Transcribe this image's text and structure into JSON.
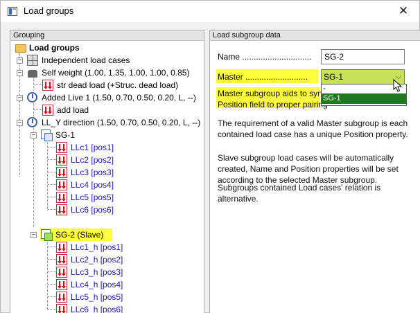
{
  "window": {
    "title": "Load groups",
    "close": "✕"
  },
  "left_panel": {
    "header": "Grouping",
    "tree": {
      "root": "Load groups",
      "independent": "Independent load cases",
      "self_weight": "Self weight  (1.00, 1.35, 1.00, 1.00, 0.85)",
      "str_dead": "str dead load  (+Struc. dead load)",
      "added_live": "Added Live 1  (1.50, 0.70, 0.50, 0.20, L, --)",
      "add_load": "add load",
      "ll_y": "LL_Y direction  (1.50, 0.70, 0.50, 0.20, L, --)",
      "sg1": "SG-1",
      "sg1_items": [
        "LLc1  [pos1]",
        "LLc2  [pos2]",
        "LLc3  [pos3]",
        "LLc4  [pos4]",
        "LLc5  [pos5]",
        "LLc6  [pos6]"
      ],
      "sg2": "SG-2  (Slave)",
      "sg2_items": [
        "LLc1_h  [pos1]",
        "LLc2_h  [pos2]",
        "LLc3_h  [pos3]",
        "LLc4_h  [pos4]",
        "LLc5_h  [pos5]",
        "LLc6_h  [pos6]"
      ]
    }
  },
  "right_panel": {
    "header": "Load subgroup data",
    "name_label": "Name ..............................",
    "name_value": "SG-2",
    "master_label": "Master ...........................",
    "master_value": "SG-1",
    "master_options": [
      "-",
      "SG-1"
    ],
    "para1a": "Master subgroup aids to synch",
    "para1b": "Position field to proper pairing",
    "para2": "The requirement of a valid Master subgroup is each contained load case has a unique Position property.",
    "para3": "Slave subgroup load cases will be automatically created, Name and Position properties will be set according to the selected Master subgroup.",
    "para4": "Subgroups contained Load cases' relation is alternative."
  },
  "colors": {
    "highlight": "#ffff3b",
    "select_bg": "#c8e15a",
    "selected_option": "#1f7a1f",
    "link_blue": "#1a1aa0"
  }
}
